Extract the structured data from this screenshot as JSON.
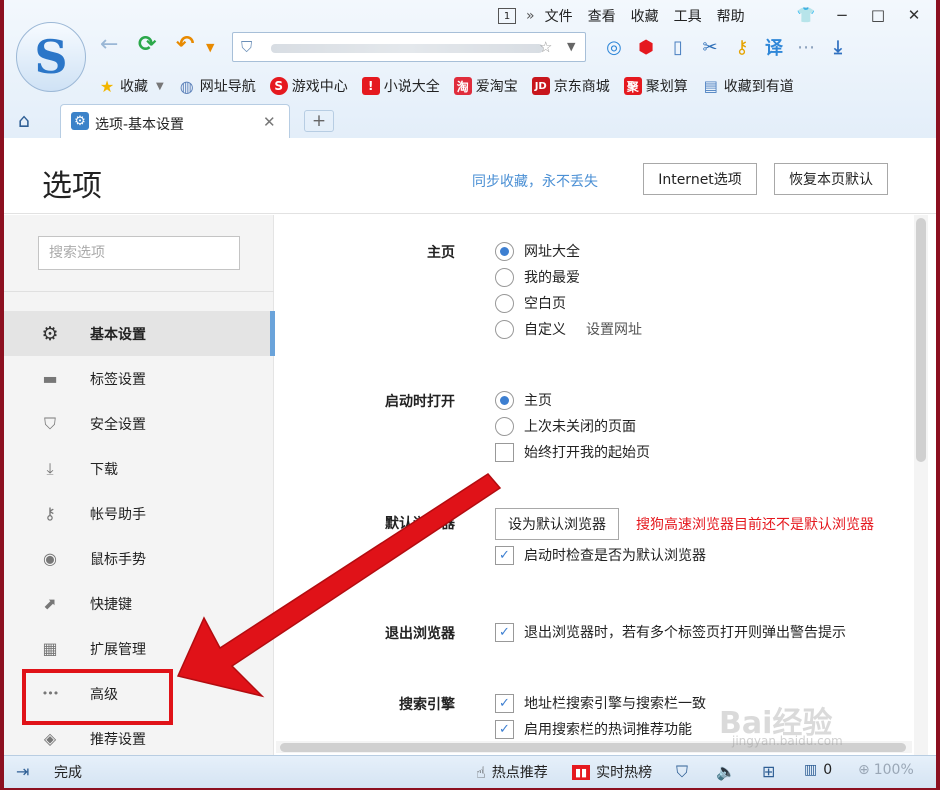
{
  "browser": {
    "menu": {
      "page_box": "1",
      "items": [
        "文件",
        "查看",
        "收藏",
        "工具",
        "帮助"
      ]
    },
    "window_buttons": [
      "−",
      "□",
      "✕"
    ],
    "bookmarks": [
      {
        "label": "收藏",
        "icon": "star-icon",
        "color": "#f2b600"
      },
      {
        "label": "网址导航",
        "icon": "globe-icon",
        "color": "#5a7fb8"
      },
      {
        "label": "游戏中心",
        "icon": "game-icon",
        "color": "#e5191f"
      },
      {
        "label": "小说大全",
        "icon": "book-icon",
        "color": "#e5191f"
      },
      {
        "label": "爱淘宝",
        "icon": "taobao-icon",
        "color": "#e02d3c"
      },
      {
        "label": "京东商城",
        "icon": "jd-icon",
        "color": "#c8161d"
      },
      {
        "label": "聚划算",
        "icon": "juhuasuan-icon",
        "color": "#e5191f"
      },
      {
        "label": "收藏到有道",
        "icon": "youdao-icon",
        "color": "#4a7fc0"
      }
    ],
    "tab": {
      "title": "选项-基本设置",
      "close": "✕"
    },
    "new_tab": "+"
  },
  "header": {
    "title": "选项",
    "sync_link": "同步收藏，永不丢失",
    "internet_options": "Internet选项",
    "restore_default": "恢复本页默认"
  },
  "sidebar": {
    "search_placeholder": "搜索选项",
    "items": [
      {
        "label": "基本设置",
        "icon": "gear-icon",
        "glyph": "⚙",
        "active": true
      },
      {
        "label": "标签设置",
        "icon": "tab-icon",
        "glyph": "▬",
        "active": false
      },
      {
        "label": "安全设置",
        "icon": "shield-check-icon",
        "glyph": "⛉",
        "active": false
      },
      {
        "label": "下载",
        "icon": "download-icon",
        "glyph": "⤓",
        "active": false
      },
      {
        "label": "帐号助手",
        "icon": "key-icon",
        "glyph": "⚷",
        "active": false
      },
      {
        "label": "鼠标手势",
        "icon": "mouse-icon",
        "glyph": "◉",
        "active": false
      },
      {
        "label": "快捷键",
        "icon": "shortcut-arrow-icon",
        "glyph": "⬈",
        "active": false
      },
      {
        "label": "扩展管理",
        "icon": "extension-grid-icon",
        "glyph": "▦",
        "active": false
      },
      {
        "label": "高级",
        "icon": "more-dots-icon",
        "glyph": "•••",
        "active": false
      },
      {
        "label": "推荐设置",
        "icon": "recommend-icon",
        "glyph": "◈",
        "active": false
      }
    ]
  },
  "content": {
    "homepage": {
      "label": "主页",
      "options": [
        "网址大全",
        "我的最爱",
        "空白页",
        "自定义"
      ],
      "selected": 0,
      "custom_link": "设置网址"
    },
    "startup": {
      "label": "启动时打开",
      "options": [
        "主页",
        "上次未关闭的页面"
      ],
      "selected": 0,
      "checkbox": "始终打开我的起始页",
      "checked": false
    },
    "default_browser": {
      "label": "默认浏览器",
      "button": "设为默认浏览器",
      "warning": "搜狗高速浏览器目前还不是默认浏览器",
      "checkbox": "启动时检查是否为默认浏览器",
      "checked": true
    },
    "exit": {
      "label": "退出浏览器",
      "checkbox": "退出浏览器时，若有多个标签页打开则弹出警告提示",
      "checked": true
    },
    "search_engine": {
      "label": "搜索引擎",
      "checkboxes": [
        "地址栏搜索引擎与搜索栏一致",
        "启用搜索栏的热词推荐功能"
      ],
      "checked": [
        true,
        true
      ]
    }
  },
  "status_bar": {
    "status": "完成",
    "hot_recommend": "热点推荐",
    "realtime_hot": "实时热榜",
    "counter": "0",
    "zoom": "100%"
  },
  "watermark": {
    "text": "Bai经验",
    "url": "jingyan.baidu.com"
  },
  "colors": {
    "accent": "#3d7fd1",
    "warning": "#e5191f",
    "annotation": "#e01218",
    "frame": "#8c1020"
  }
}
